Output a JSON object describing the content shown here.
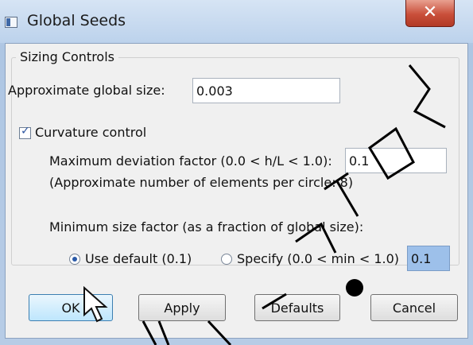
{
  "window": {
    "title": "Global Seeds",
    "close_glyph": "✕"
  },
  "sizing": {
    "group_label": "Sizing Controls",
    "global_size_label": "Approximate global size:",
    "global_size_value": "0.003",
    "curvature_label": "Curvature control",
    "curvature_checked": true,
    "deviation_label": "Maximum deviation factor (0.0 < h/L < 1.0):",
    "deviation_value": "0.1",
    "elements_note": "(Approximate number of elements per circle: 8)",
    "min_size_label": "Minimum size factor (as a fraction of global size):",
    "use_default_label": "Use default (0.1)",
    "specify_label": "Specify (0.0 < min < 1.0)",
    "specify_value": "0.1",
    "selected_option": "use_default"
  },
  "buttons": {
    "ok": "OK",
    "apply": "Apply",
    "defaults": "Defaults",
    "cancel": "Cancel"
  },
  "icons": {
    "window": "window-icon",
    "cursor": "mouse-pointer-icon"
  },
  "colors": {
    "accent": "#2a5aa8",
    "close": "#c94f3a",
    "selected_field": "#9dc0ea"
  }
}
